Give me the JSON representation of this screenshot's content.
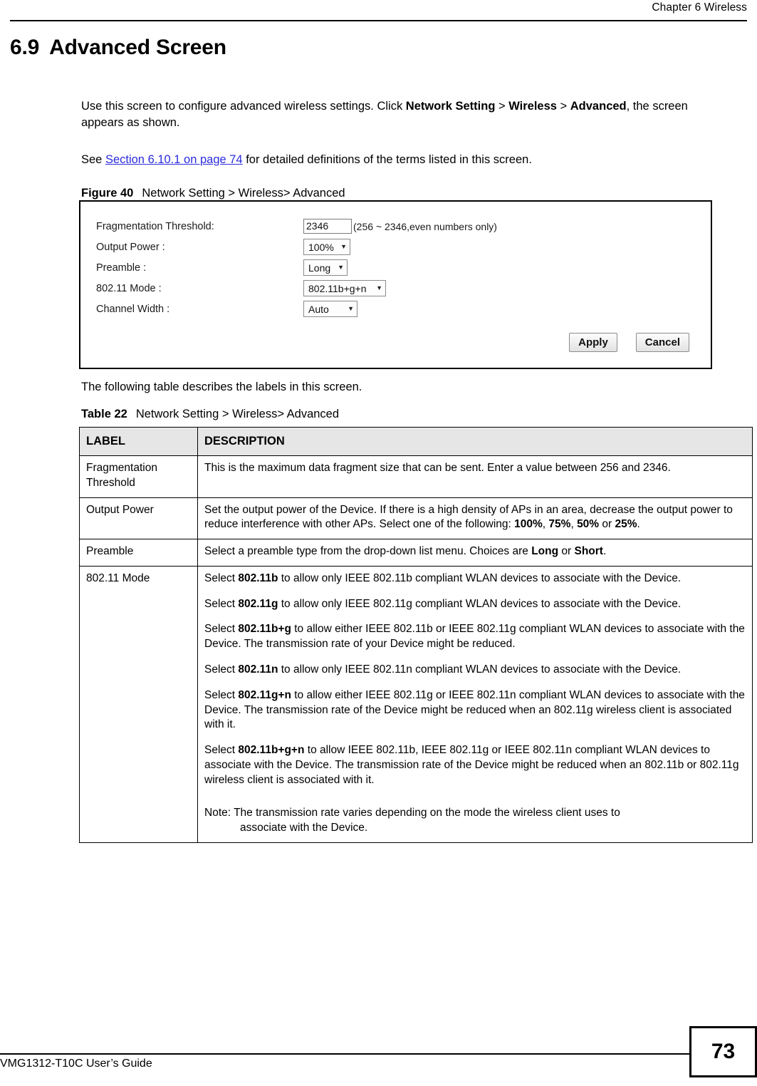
{
  "header": {
    "chapter": "Chapter 6 Wireless"
  },
  "section": {
    "number": "6.9",
    "title": "Advanced Screen"
  },
  "intro": {
    "p1_a": "Use this screen to configure advanced wireless settings. Click ",
    "p1_b1": "Network Setting",
    "p1_c": " > ",
    "p1_b2": "Wireless",
    "p1_d": " > ",
    "p1_b3": "Advanced",
    "p1_e": ", the screen appears as shown.",
    "p2_a": "See ",
    "p2_link": "Section 6.10.1 on page 74",
    "p2_b": " for detailed definitions of the terms listed in this screen.",
    "p3": "The following table describes the labels in this screen."
  },
  "figure": {
    "caption_label": "Figure 40",
    "caption_text": "Network Setting > Wireless> Advanced",
    "fields": [
      {
        "label": "Fragmentation Threshold:",
        "type": "text",
        "value": "2346",
        "hint": "(256 ~ 2346,even numbers only)"
      },
      {
        "label": "Output Power :",
        "type": "select",
        "value": "100%"
      },
      {
        "label": "Preamble :",
        "type": "select",
        "value": "Long"
      },
      {
        "label": "802.11 Mode :",
        "type": "select",
        "value": "802.11b+g+n"
      },
      {
        "label": "Channel Width :",
        "type": "select",
        "value": "Auto"
      }
    ],
    "apply_label": "Apply",
    "cancel_label": "Cancel",
    "caret_glyph": "▼"
  },
  "table": {
    "caption_label": "Table 22",
    "caption_text": "Network Setting > Wireless> Advanced",
    "columns": [
      "LABEL",
      "DESCRIPTION"
    ],
    "rows": {
      "fragmentation": {
        "label": "Fragmentation Threshold",
        "desc": "This is the maximum data fragment size that can be sent. Enter a value between 256 and 2346."
      },
      "output_power": {
        "label": "Output Power",
        "desc_a": "Set the output power of the Device. If there is a high density of APs in an area, decrease the output power to reduce interference with other APs. Select one of the following: ",
        "v1": "100%",
        "sep1": ", ",
        "v2": "75%",
        "sep2": ", ",
        "v3": "50%",
        "sep3": " or ",
        "v4": "25%",
        "desc_end": "."
      },
      "preamble": {
        "label": "Preamble",
        "desc_a": "Select a preamble type from the drop-down list menu. Choices are ",
        "v1": "Long",
        "sep1": " or ",
        "v2": "Short",
        "desc_end": "."
      },
      "mode": {
        "label": "802.11 Mode",
        "p1_a": "Select ",
        "p1_b": "802.11b",
        "p1_c": " to allow only IEEE 802.11b compliant WLAN devices to associate with the Device.",
        "p2_a": "Select ",
        "p2_b": "802.11g",
        "p2_c": " to allow only IEEE 802.11g compliant WLAN devices to associate with the Device.",
        "p3_a": "Select ",
        "p3_b": "802.11b+g",
        "p3_c": " to allow either IEEE 802.11b or IEEE 802.11g compliant WLAN devices to associate with the Device. The transmission rate of your Device might be reduced.",
        "p4_a": "Select ",
        "p4_b": "802.11n",
        "p4_c": " to allow only IEEE 802.11n compliant WLAN devices to associate with the Device.",
        "p5_a": "Select ",
        "p5_b": "802.11g+n",
        "p5_c": " to allow either IEEE 802.11g or IEEE 802.11n compliant WLAN devices to associate with the Device. The transmission rate of the Device might be reduced when an 802.11g wireless client is associated with it.",
        "p6_a": "Select ",
        "p6_b": "802.11b+g+n",
        "p6_c": " to allow IEEE 802.11b, IEEE 802.11g or IEEE 802.11n compliant WLAN devices to associate with the Device. The transmission rate of the Device might be reduced when an 802.11b or 802.11g wireless client is associated with it.",
        "note_a": "Note: The transmission rate varies depending on the mode the wireless client uses to",
        "note_b": "associate with the Device."
      }
    }
  },
  "footer": {
    "guide": "VMG1312-T10C User’s Guide",
    "page_number": "73"
  }
}
